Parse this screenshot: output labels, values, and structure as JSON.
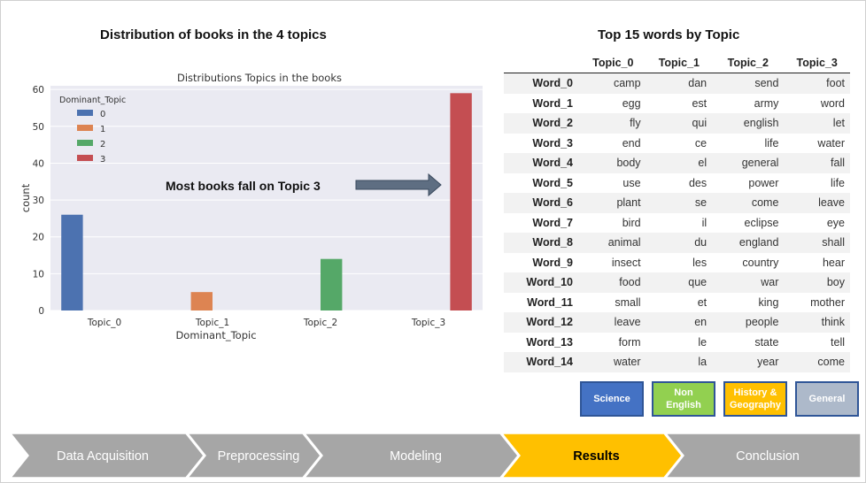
{
  "headings": {
    "left": "Distribution of books in the 4 topics",
    "right": "Top 15 words by Topic"
  },
  "chart_data": {
    "type": "bar",
    "title": "Distributions Topics in the books",
    "xlabel": "Dominant_Topic",
    "ylabel": "count",
    "ylim": [
      0,
      61
    ],
    "yticks": [
      0,
      10,
      20,
      30,
      40,
      50,
      60
    ],
    "categories": [
      "Topic_0",
      "Topic_1",
      "Topic_2",
      "Topic_3"
    ],
    "legend": {
      "title": "Dominant_Topic",
      "placement": "top-left"
    },
    "grid": true,
    "background": "#eaeaf2",
    "series": [
      {
        "name": "0",
        "color": "#4c72b0",
        "values": [
          26,
          0,
          0,
          0
        ]
      },
      {
        "name": "1",
        "color": "#dd8452",
        "values": [
          0,
          5,
          0,
          0
        ]
      },
      {
        "name": "2",
        "color": "#55a868",
        "values": [
          0,
          0,
          14,
          0
        ]
      },
      {
        "name": "3",
        "color": "#c44e52",
        "values": [
          0,
          0,
          0,
          59
        ]
      }
    ],
    "annotation": {
      "text": "Most books fall on Topic 3",
      "arrow_color": "#5e6e82"
    }
  },
  "table": {
    "columns": [
      "Topic_0",
      "Topic_1",
      "Topic_2",
      "Topic_3"
    ],
    "rows": [
      {
        "label": "Word_0",
        "cells": [
          "camp",
          "dan",
          "send",
          "foot"
        ]
      },
      {
        "label": "Word_1",
        "cells": [
          "egg",
          "est",
          "army",
          "word"
        ]
      },
      {
        "label": "Word_2",
        "cells": [
          "fly",
          "qui",
          "english",
          "let"
        ]
      },
      {
        "label": "Word_3",
        "cells": [
          "end",
          "ce",
          "life",
          "water"
        ]
      },
      {
        "label": "Word_4",
        "cells": [
          "body",
          "el",
          "general",
          "fall"
        ]
      },
      {
        "label": "Word_5",
        "cells": [
          "use",
          "des",
          "power",
          "life"
        ]
      },
      {
        "label": "Word_6",
        "cells": [
          "plant",
          "se",
          "come",
          "leave"
        ]
      },
      {
        "label": "Word_7",
        "cells": [
          "bird",
          "il",
          "eclipse",
          "eye"
        ]
      },
      {
        "label": "Word_8",
        "cells": [
          "animal",
          "du",
          "england",
          "shall"
        ]
      },
      {
        "label": "Word_9",
        "cells": [
          "insect",
          "les",
          "country",
          "hear"
        ]
      },
      {
        "label": "Word_10",
        "cells": [
          "food",
          "que",
          "war",
          "boy"
        ]
      },
      {
        "label": "Word_11",
        "cells": [
          "small",
          "et",
          "king",
          "mother"
        ]
      },
      {
        "label": "Word_12",
        "cells": [
          "leave",
          "en",
          "people",
          "think"
        ]
      },
      {
        "label": "Word_13",
        "cells": [
          "form",
          "le",
          "state",
          "tell"
        ]
      },
      {
        "label": "Word_14",
        "cells": [
          "water",
          "la",
          "year",
          "come"
        ]
      }
    ]
  },
  "topic_labels": [
    {
      "line1": "Science",
      "line2": "",
      "color": "#4472c4",
      "text_color": "#ffffff"
    },
    {
      "line1": "Non",
      "line2": "English",
      "color": "#92d050",
      "text_color": "#ffffff"
    },
    {
      "line1": "History &",
      "line2": "Geography",
      "color": "#ffc000",
      "text_color": "#ffffff"
    },
    {
      "line1": "General",
      "line2": "",
      "color": "#adb9ca",
      "text_color": "#ffffff"
    }
  ],
  "process_steps": [
    {
      "label": "Data Acquisition",
      "active": false
    },
    {
      "label": "Preprocessing",
      "active": false
    },
    {
      "label": "Modeling",
      "active": false
    },
    {
      "label": "Results",
      "active": true
    },
    {
      "label": "Conclusion",
      "active": false
    }
  ],
  "process_colors": {
    "inactive": "#a6a6a6",
    "active": "#ffc000",
    "inactive_text": "#ffffff",
    "active_text": "#000000"
  }
}
